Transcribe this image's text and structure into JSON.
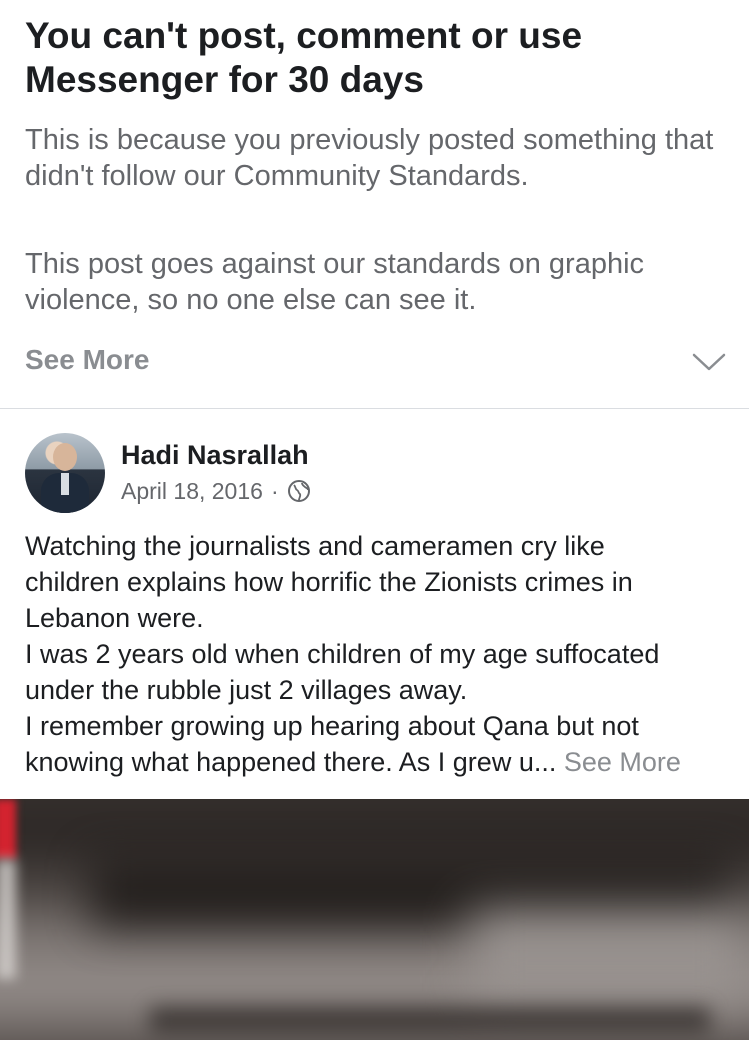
{
  "restriction_notice": {
    "title": "You can't post, comment or use Messenger for 30 days",
    "reason": "This is because you previously posted something that didn't follow our Community Standards.",
    "detail": "This post goes against our standards on graphic violence, so no one else can see it.",
    "see_more_label": "See More",
    "chevron_icon": "chevron-down-icon"
  },
  "post": {
    "author": "Hadi Nasrallah",
    "date": "April 18, 2016",
    "separator": "·",
    "audience_icon": "globe-icon",
    "text_lines": [
      "Watching the journalists and cameramen cry like",
      "children explains how horrific the Zionists crimes in",
      "Lebanon were.",
      "I was 2 years old when children of my age suffocated",
      "under the rubble just 2 villages away.",
      "I remember growing up hearing about Qana but not",
      "knowing what happened there. As I grew u..."
    ],
    "see_more_label": "See More"
  },
  "colors": {
    "title_text": "#1c1e21",
    "secondary_text": "#65676b",
    "see_more_text": "#8a8d91",
    "divider": "#dadde1"
  }
}
